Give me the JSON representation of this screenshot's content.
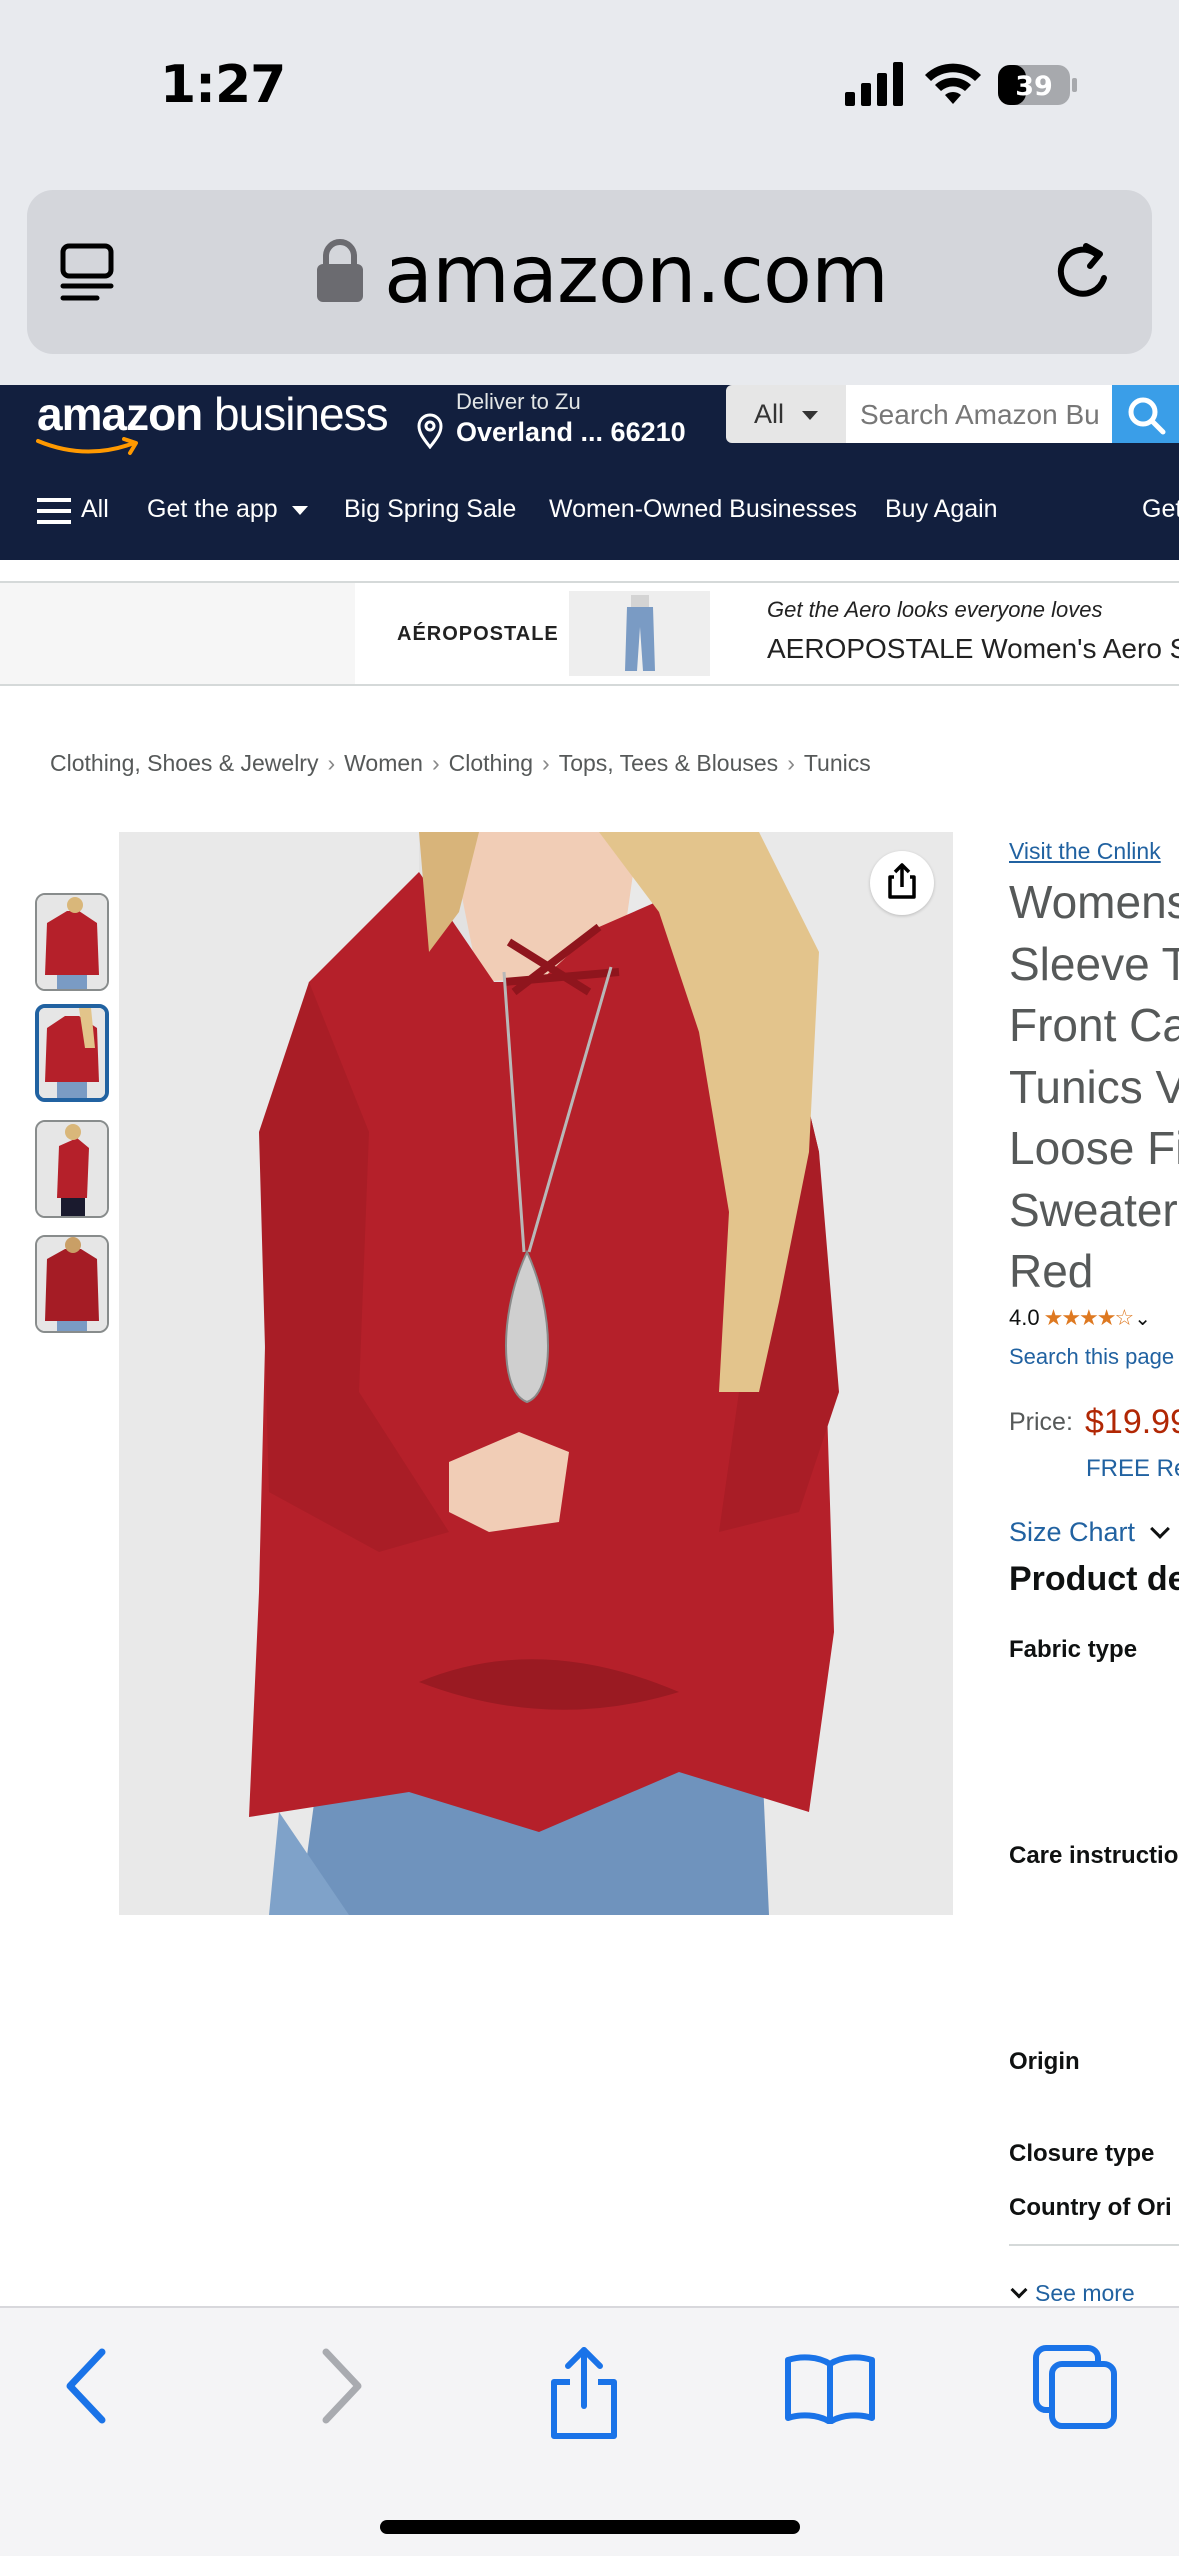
{
  "status_bar": {
    "time": "1:27",
    "battery": "39"
  },
  "browser": {
    "url": "amazon.com"
  },
  "header": {
    "logo_brand": "amazon",
    "logo_suffix": "business",
    "deliver_to": "Deliver to Zu",
    "location": "Overland ... 66210",
    "search_category": "All",
    "search_placeholder": "Search Amazon Bu",
    "nav": [
      {
        "label": "All"
      },
      {
        "label": "Get the app"
      },
      {
        "label": "Big Spring Sale"
      },
      {
        "label": "Women-Owned Businesses"
      },
      {
        "label": "Buy Again"
      },
      {
        "label": "Get"
      }
    ]
  },
  "ad": {
    "brand": "AÉROPOSTALE",
    "tagline": "Get the Aero looks everyone loves",
    "title": "AEROPOSTALE Women's Aero Stre"
  },
  "breadcrumb": [
    "Clothing, Shoes & Jewelry",
    "Women",
    "Clothing",
    "Tops, Tees & Blouses",
    "Tunics"
  ],
  "product": {
    "visit_store": "Visit the Cnlink",
    "title_lines": [
      "Womens",
      "Sleeve T",
      "Front Ca",
      "Tunics V",
      "Loose Fi",
      "Sweaters",
      "Red"
    ],
    "rating": "4.0",
    "stars": "★★★★☆",
    "search_page": "Search this page",
    "price_label": "Price:",
    "price": "$19.99",
    "free_returns": "FREE Re",
    "size_chart": "Size Chart",
    "details_heading": "Product de",
    "details": [
      {
        "label": "Fabric type"
      },
      {
        "label": "Care instructio"
      },
      {
        "label": "Origin"
      },
      {
        "label": "Closure type"
      },
      {
        "label": "Country of Ori"
      }
    ],
    "see_more": "See more"
  },
  "colors": {
    "header_bg": "#121f3e",
    "link": "#2162a1",
    "price": "#b12704",
    "star": "#de7921",
    "shirt": "#b5202a",
    "ios_blue": "#1a73e8"
  },
  "icons": [
    "reader-icon",
    "lock-icon",
    "reload-icon",
    "location-pin-icon",
    "search-icon",
    "hamburger-icon",
    "share-icon",
    "back-icon",
    "forward-icon",
    "share-sheet-icon",
    "bookmarks-icon",
    "tabs-icon"
  ]
}
